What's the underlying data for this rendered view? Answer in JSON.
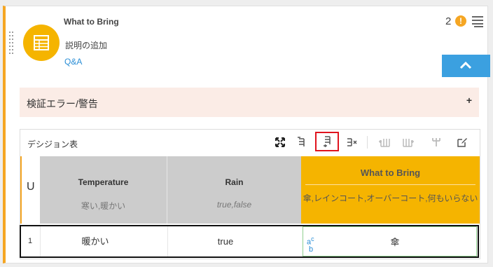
{
  "node": {
    "title": "What to Bring",
    "description": "説明の追加",
    "qa_link": "Q&A",
    "warning_count": "2",
    "warning_badge": "!"
  },
  "validation": {
    "label": "検証エラー/警告",
    "expand": "+"
  },
  "decision_table": {
    "label": "デシジョン表",
    "hit_policy": "U",
    "inputs": [
      {
        "name": "Temperature",
        "values": "寒い,暖かい"
      },
      {
        "name": "Rain",
        "values": "true,false"
      }
    ],
    "output": {
      "name": "What to Bring",
      "values": "傘,レインコート,オーバーコート,何もいらない"
    },
    "rows": [
      {
        "number": "1",
        "temperature": "暖かい",
        "rain": "true",
        "output": "傘",
        "type_icon": "a b c"
      }
    ],
    "toolbar": [
      "fullscreen-icon",
      "add-rule-above-icon",
      "add-rule-below-icon",
      "delete-rule-icon",
      "add-input-icon",
      "add-output-icon",
      "merge-icon",
      "edit-icon"
    ]
  },
  "colors": {
    "accent": "#f5a623",
    "output_header": "#f5b400",
    "collapse": "#3ba0e0",
    "error_bg": "#fbece6",
    "selected_outline": "#e0141e"
  }
}
